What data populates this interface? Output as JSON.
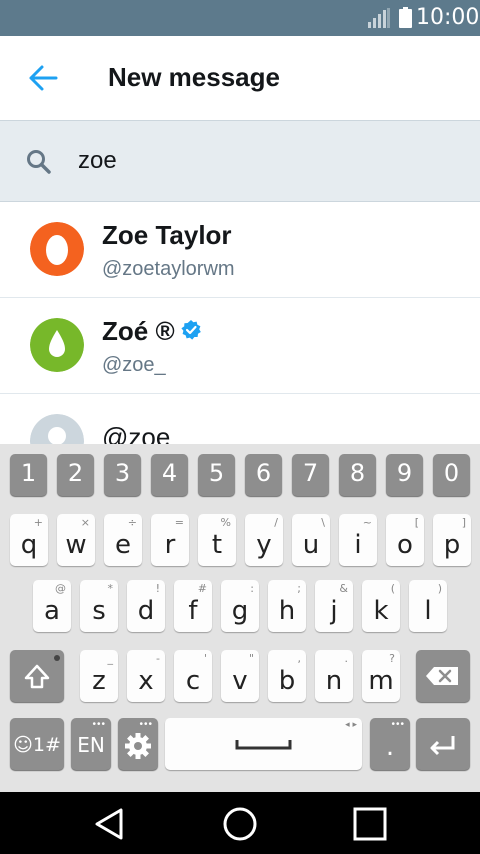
{
  "status_bar": {
    "time": "10:00"
  },
  "header": {
    "title": "New message"
  },
  "search": {
    "value": "zoe"
  },
  "results": [
    {
      "name": "Zoe Taylor",
      "handle": "@zoetaylorwm",
      "avatar_color": "#f4621f",
      "verified": false
    },
    {
      "name": "Zoé ®",
      "handle": "@zoe_",
      "avatar_color": "#77b82a",
      "verified": true
    },
    {
      "name": "@zoe",
      "handle": "",
      "avatar_color": "#ccd6dd",
      "verified": false
    }
  ],
  "keyboard": {
    "number_row": [
      "1",
      "2",
      "3",
      "4",
      "5",
      "6",
      "7",
      "8",
      "9",
      "0"
    ],
    "row1": [
      {
        "k": "q",
        "s": "+"
      },
      {
        "k": "w",
        "s": "×"
      },
      {
        "k": "e",
        "s": "÷"
      },
      {
        "k": "r",
        "s": "="
      },
      {
        "k": "t",
        "s": "%"
      },
      {
        "k": "y",
        "s": "/"
      },
      {
        "k": "u",
        "s": "\\"
      },
      {
        "k": "i",
        "s": "~"
      },
      {
        "k": "o",
        "s": "["
      },
      {
        "k": "p",
        "s": "]"
      }
    ],
    "row2": [
      {
        "k": "a",
        "s": "@"
      },
      {
        "k": "s",
        "s": "*"
      },
      {
        "k": "d",
        "s": "!"
      },
      {
        "k": "f",
        "s": "#"
      },
      {
        "k": "g",
        "s": ":"
      },
      {
        "k": "h",
        "s": ";"
      },
      {
        "k": "j",
        "s": "&"
      },
      {
        "k": "k",
        "s": "("
      },
      {
        "k": "l",
        "s": ")"
      }
    ],
    "row3": [
      {
        "k": "z",
        "s": "_"
      },
      {
        "k": "x",
        "s": "-"
      },
      {
        "k": "c",
        "s": "'"
      },
      {
        "k": "v",
        "s": "\""
      },
      {
        "k": "b",
        "s": ","
      },
      {
        "k": "n",
        "s": "."
      },
      {
        "k": "m",
        "s": "?"
      }
    ],
    "emoji_label": "☺1#",
    "lang_label": "EN",
    "period": ".",
    "period_hint": ",",
    "space_hint": "◂ ▸"
  },
  "colors": {
    "accent": "#1da1f2",
    "status_bar": "#5d7a8c",
    "search_bg": "#e6ecf0",
    "keyboard_bg": "#e3e3e3",
    "dark_key": "#8e8e8e"
  },
  "icons": {
    "back": "arrow-left-icon",
    "search": "magnifier-icon",
    "verified": "verified-badge-icon",
    "shift": "shift-arrow-icon",
    "backspace": "backspace-icon",
    "settings": "gear-icon",
    "enter": "enter-arrow-icon",
    "nav_back": "triangle-back-icon",
    "nav_home": "circle-home-icon",
    "nav_recent": "square-recents-icon"
  }
}
